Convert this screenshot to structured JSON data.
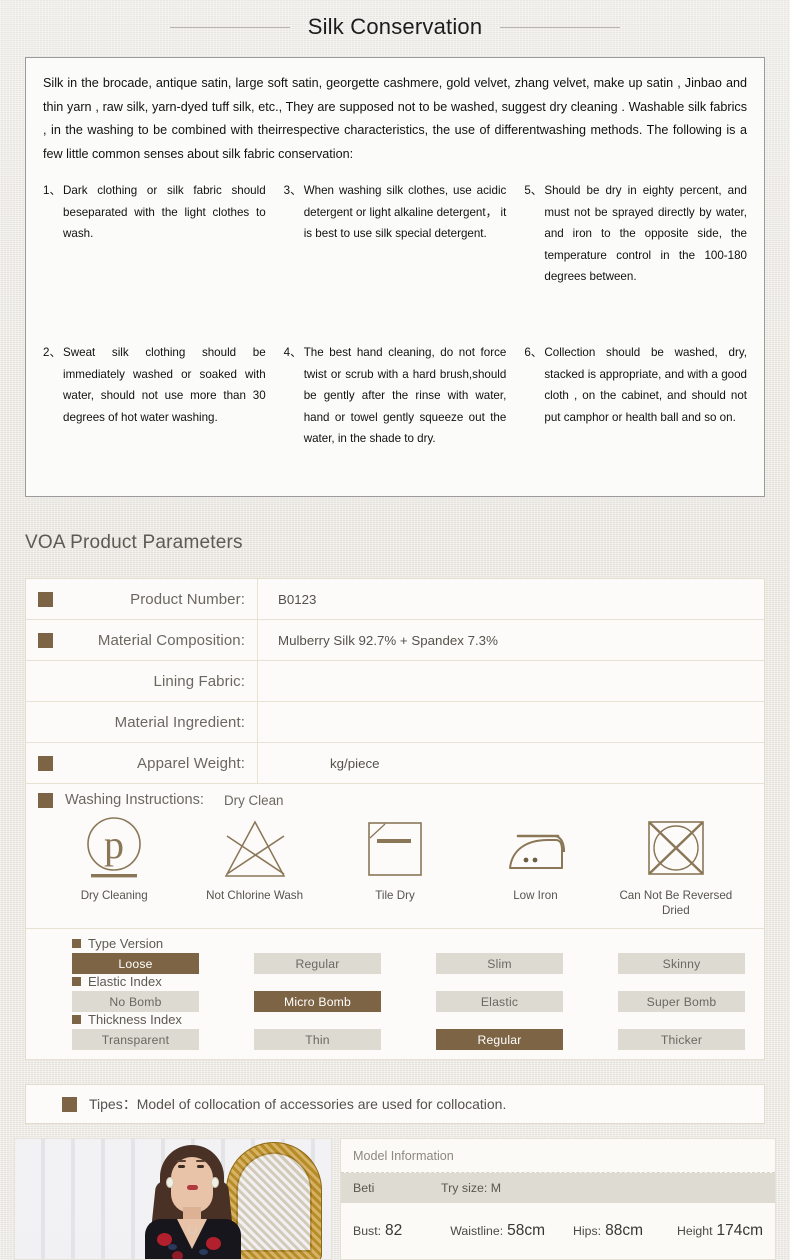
{
  "header": {
    "title": "Silk Conservation"
  },
  "conservation": {
    "intro": "Silk in the brocade, antique satin, large soft satin, georgette cashmere, gold velvet, zhang velvet, make up satin , Jinbao and thin yarn , raw silk, yarn-dyed tuff silk, etc., They are supposed not to be washed, suggest dry cleaning . Washable silk fabrics , in the washing to be combined with theirrespective characteristics, the use of differentwashing methods. The following is a few little common senses about silk fabric conservation:",
    "tips": [
      {
        "num": "1、",
        "text": "Dark clothing or silk fabric should beseparated with the light clothes to wash."
      },
      {
        "num": "3、",
        "text": "When washing silk clothes, use acidic detergent or light alkaline detergent， it is best to use silk special detergent."
      },
      {
        "num": "5、",
        "text": "Should be dry in eighty percent, and must not be sprayed directly by water, and iron to the opposite side, the temperature control in the 100-180 degrees between."
      },
      {
        "num": "2、",
        "text": "Sweat silk clothing should be immediately washed or soaked with water, should not use more than 30 degrees of hot water washing."
      },
      {
        "num": "4、",
        "text": "The best hand cleaning, do not force twist or scrub with a hard brush,should be gently after the rinse with water, hand or towel gently squeeze out the water, in the shade to dry."
      },
      {
        "num": "6、",
        "text": "Collection should be washed, dry, stacked is appropriate, and with a good cloth , on the cabinet, and should not put camphor or health ball and so on."
      }
    ]
  },
  "parameters": {
    "section_title": "VOA Product Parameters",
    "rows": [
      {
        "marker": true,
        "label": "Product Number:",
        "value": "B0123",
        "indent": false
      },
      {
        "marker": true,
        "label": "Material Composition:",
        "value": "Mulberry Silk 92.7% + Spandex 7.3%",
        "indent": false
      },
      {
        "marker": false,
        "label": "Lining Fabric:",
        "value": "",
        "indent": false
      },
      {
        "marker": false,
        "label": "Material Ingredient:",
        "value": "",
        "indent": false
      },
      {
        "marker": true,
        "label": "Apparel Weight:",
        "value": "kg/piece",
        "indent": true
      }
    ],
    "washing": {
      "label": "Washing Instructions:",
      "value": "Dry Clean",
      "icons": [
        {
          "name": "dry-cleaning",
          "label": "Dry Cleaning"
        },
        {
          "name": "not-chlorine",
          "label": "Not Chlorine Wash"
        },
        {
          "name": "tile-dry",
          "label": "Tile Dry"
        },
        {
          "name": "low-iron",
          "label": "Low Iron"
        },
        {
          "name": "no-tumble-dry",
          "label": "Can Not Be Reversed Dried"
        }
      ]
    },
    "indexes": [
      {
        "name": "Type Version",
        "options": [
          {
            "label": "Loose",
            "active": true
          },
          {
            "label": "Regular",
            "active": false
          },
          {
            "label": "Slim",
            "active": false
          },
          {
            "label": "Skinny",
            "active": false
          }
        ]
      },
      {
        "name": "Elastic Index",
        "options": [
          {
            "label": "No  Bomb",
            "active": false
          },
          {
            "label": "Micro  Bomb",
            "active": true
          },
          {
            "label": "Elastic",
            "active": false
          },
          {
            "label": "Super  Bomb",
            "active": false
          }
        ]
      },
      {
        "name": "Thickness Index",
        "options": [
          {
            "label": "Transparent",
            "active": false
          },
          {
            "label": "Thin",
            "active": false
          },
          {
            "label": "Regular",
            "active": true
          },
          {
            "label": "Thicker",
            "active": false
          }
        ]
      }
    ],
    "tipes": "Tipes：Model of collocation of accessories are used for collocation."
  },
  "model": {
    "title": "Model Information",
    "name": "Beti",
    "try_size": "Try size: M",
    "stats": [
      {
        "label": "Bust:",
        "value": "82"
      },
      {
        "label": "Waistline:",
        "value": "58cm"
      },
      {
        "label": "Hips:",
        "value": "88cm"
      },
      {
        "label": "Height",
        "value": "174cm"
      }
    ]
  },
  "colors": {
    "accent_brown": "#7d6445",
    "chip_grey": "#dddad2",
    "page_bg": "#eceae4",
    "panel_bg": "#fbfbf9",
    "icon_stroke": "#7d6a4f"
  }
}
